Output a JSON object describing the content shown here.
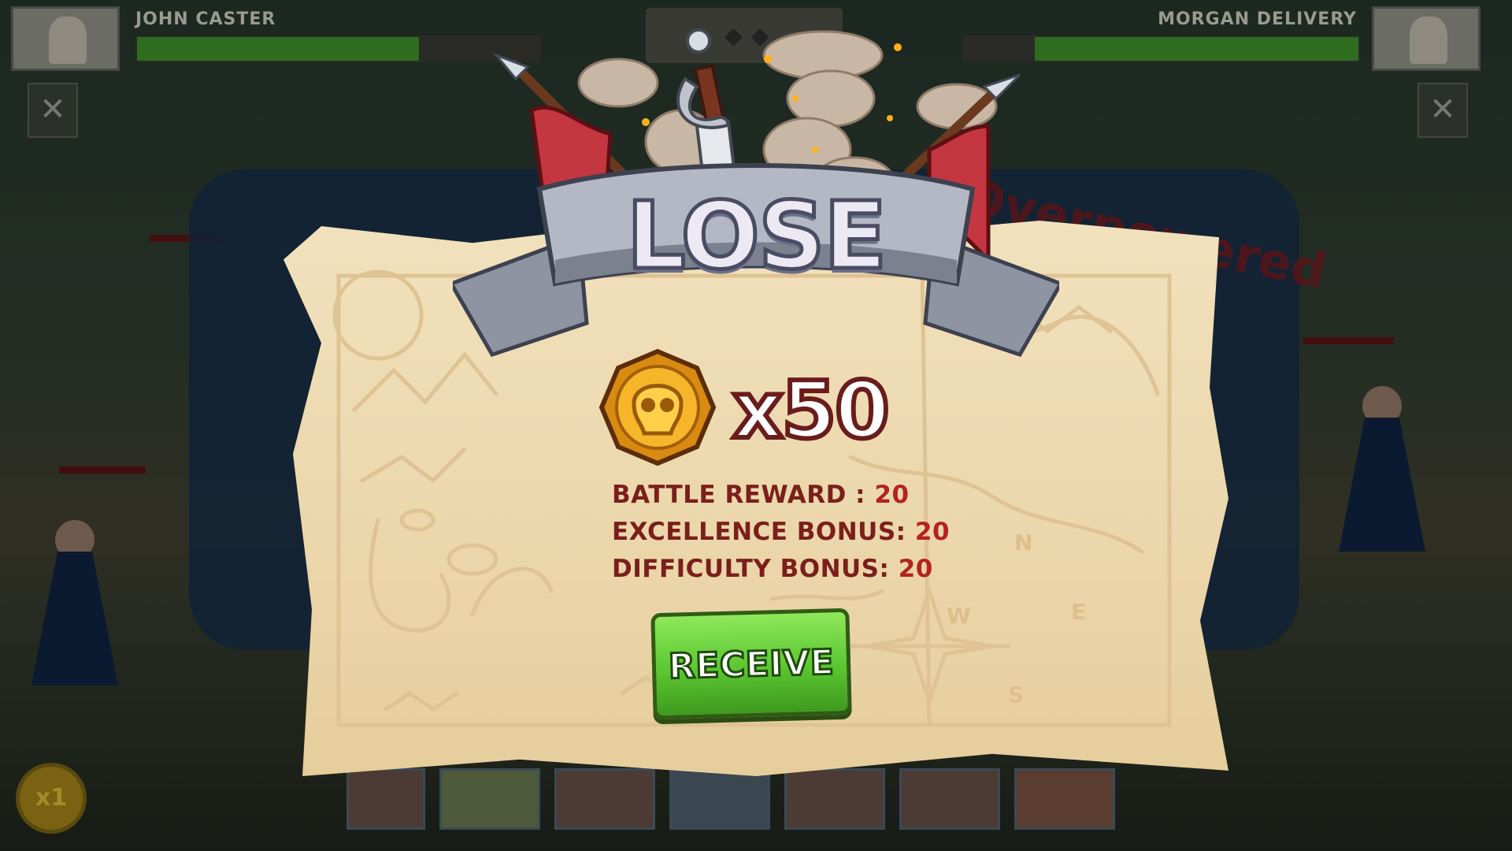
{
  "hud": {
    "player_left": {
      "name": "JOHN CASTER",
      "health_fraction": 0.7
    },
    "player_right": {
      "name": "MORGAN DELIVERY",
      "health_fraction": 0.82
    },
    "speed": "x1"
  },
  "background_banner_text": "Overpowered",
  "result": {
    "title": "LOSE",
    "coin_count": "x50",
    "rewards": [
      {
        "label": "BATTLE REWARD : ",
        "value": "20"
      },
      {
        "label": "EXCELLENCE BONUS: ",
        "value": "20"
      },
      {
        "label": "DIFFICULTY BONUS: ",
        "value": "20"
      }
    ],
    "receive_label": "RECEIVE"
  },
  "map_compass": {
    "n": "N",
    "e": "E",
    "s": "S",
    "w": "W"
  },
  "colors": {
    "accent_red": "#7a1f1c",
    "button_green": "#5bc631",
    "parchment": "#ecd7ac"
  }
}
